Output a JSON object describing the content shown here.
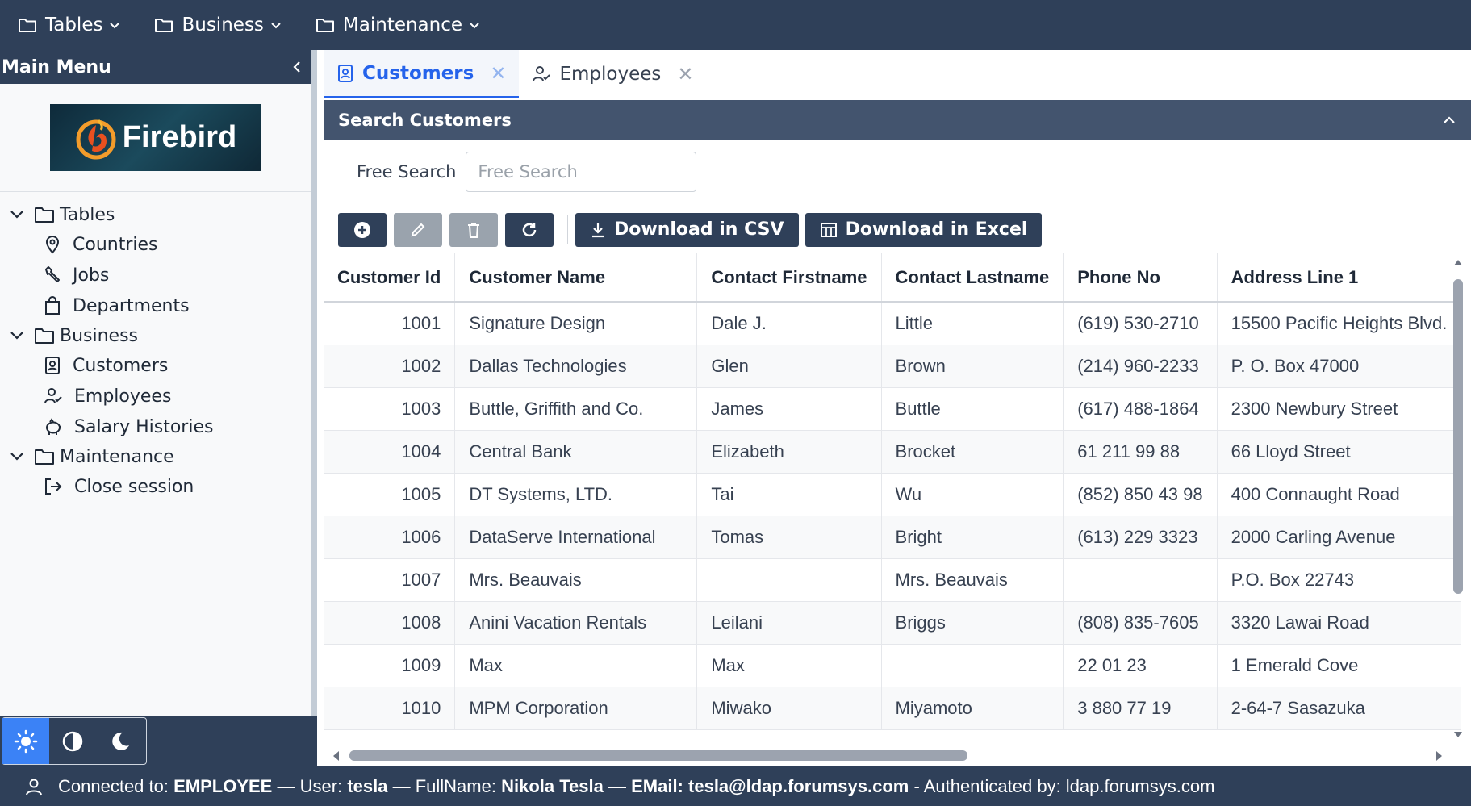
{
  "topbar": {
    "menus": [
      {
        "label": "Tables"
      },
      {
        "label": "Business"
      },
      {
        "label": "Maintenance"
      }
    ]
  },
  "sidebar": {
    "title": "Main Menu",
    "logo_text": "Firebird",
    "groups": [
      {
        "label": "Tables",
        "items": [
          "Countries",
          "Jobs",
          "Departments"
        ]
      },
      {
        "label": "Business",
        "items": [
          "Customers",
          "Employees",
          "Salary Histories"
        ]
      },
      {
        "label": "Maintenance",
        "items": [
          "Close session"
        ]
      }
    ]
  },
  "tabs": [
    {
      "label": "Customers",
      "active": true
    },
    {
      "label": "Employees",
      "active": false
    }
  ],
  "search_panel": {
    "title": "Search Customers",
    "free_search_label": "Free Search",
    "free_search_placeholder": "Free Search",
    "free_search_value": ""
  },
  "toolbar": {
    "download_csv": "Download in CSV",
    "download_excel": "Download in Excel"
  },
  "table": {
    "columns": [
      "Customer Id",
      "Customer Name",
      "Contact Firstname",
      "Contact Lastname",
      "Phone No",
      "Address Line 1"
    ],
    "rows": [
      [
        "1001",
        "Signature Design",
        "Dale J.",
        "Little",
        "(619) 530-2710",
        "15500 Pacific Heights Blvd."
      ],
      [
        "1002",
        "Dallas Technologies",
        "Glen",
        "Brown",
        "(214) 960-2233",
        "P. O. Box 47000"
      ],
      [
        "1003",
        "Buttle, Griffith and Co.",
        "James",
        "Buttle",
        "(617) 488-1864",
        "2300 Newbury Street"
      ],
      [
        "1004",
        "Central Bank",
        "Elizabeth",
        "Brocket",
        "61 211 99 88",
        "66 Lloyd Street"
      ],
      [
        "1005",
        "DT Systems, LTD.",
        "Tai",
        "Wu",
        "(852) 850 43 98",
        "400 Connaught Road"
      ],
      [
        "1006",
        "DataServe International",
        "Tomas",
        "Bright",
        "(613) 229 3323",
        "2000 Carling Avenue"
      ],
      [
        "1007",
        "Mrs. Beauvais",
        "",
        "Mrs. Beauvais",
        "",
        "P.O. Box 22743"
      ],
      [
        "1008",
        "Anini Vacation Rentals",
        "Leilani",
        "Briggs",
        "(808) 835-7605",
        "3320 Lawai Road"
      ],
      [
        "1009",
        "Max",
        "Max",
        "",
        "22 01 23",
        "1 Emerald Cove"
      ],
      [
        "1010",
        "MPM Corporation",
        "Miwako",
        "Miyamoto",
        "3 880 77 19",
        "2-64-7 Sasazuka"
      ]
    ]
  },
  "status": {
    "connected_label": "Connected to:",
    "connected_value": "EMPLOYEE",
    "sep": "—",
    "user_label": "User:",
    "user_value": "tesla",
    "fullname_label": "FullName:",
    "fullname_value": "Nikola Tesla",
    "email_label": "EMail:",
    "email_value": "tesla@ldap.forumsys.com",
    "auth_text": "- Authenticated by: ldap.forumsys.com"
  },
  "colors": {
    "navy": "#2f4059",
    "panel": "#43546e",
    "accent": "#2563eb",
    "theme_active": "#3b82f6"
  }
}
